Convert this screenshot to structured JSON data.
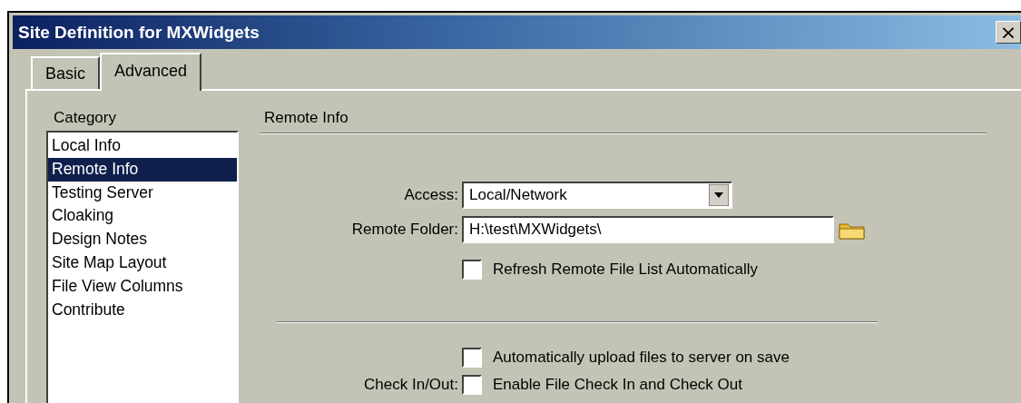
{
  "window": {
    "title": "Site Definition for MXWidgets",
    "close": "×"
  },
  "tabs": [
    {
      "label": "Basic",
      "selected": false
    },
    {
      "label": "Advanced",
      "selected": true
    }
  ],
  "category": {
    "label": "Category",
    "items": [
      {
        "label": "Local Info",
        "selected": false
      },
      {
        "label": "Remote Info",
        "selected": true
      },
      {
        "label": "Testing Server",
        "selected": false
      },
      {
        "label": "Cloaking",
        "selected": false
      },
      {
        "label": "Design Notes",
        "selected": false
      },
      {
        "label": "Site Map Layout",
        "selected": false
      },
      {
        "label": "File View Columns",
        "selected": false
      },
      {
        "label": "Contribute",
        "selected": false
      }
    ]
  },
  "section": {
    "title": "Remote Info",
    "access": {
      "label": "Access:",
      "value": "Local/Network"
    },
    "remote_folder": {
      "label": "Remote Folder:",
      "value": "H:\\test\\MXWidgets\\"
    },
    "refresh": {
      "label": "Refresh Remote File List Automatically",
      "checked": false
    },
    "auto_upload": {
      "label": "Automatically upload files to server on save",
      "checked": false
    },
    "check_in_out": {
      "label": "Check In/Out:",
      "option": "Enable File Check In and Check Out",
      "checked": false
    }
  }
}
